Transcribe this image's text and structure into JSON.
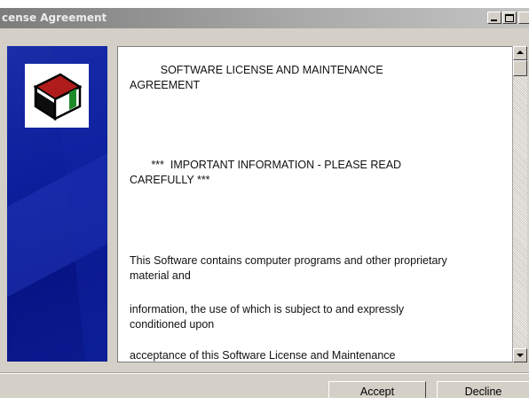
{
  "window": {
    "title": "cense Agreement"
  },
  "agreement": {
    "heading": "          SOFTWARE LICENSE AND MAINTENANCE\nAGREEMENT",
    "important": "       ***  IMPORTANT INFORMATION - PLEASE READ\nCAREFULLY ***",
    "para1": "This Software contains computer programs and other proprietary\nmaterial and",
    "para2": "information, the use of which is subject to and expressly\nconditioned upon",
    "para3": "acceptance of this Software License and Maintenance"
  },
  "buttons": {
    "accept": "Accept",
    "decline": "Decline"
  },
  "colors": {
    "side_panel": "#0c1f9c",
    "logo_red": "#b01c1c",
    "logo_green": "#1e8a2a"
  },
  "icons": {
    "logo": "box-logo-icon",
    "minimize": "minimize-icon",
    "maximize": "maximize-icon"
  }
}
